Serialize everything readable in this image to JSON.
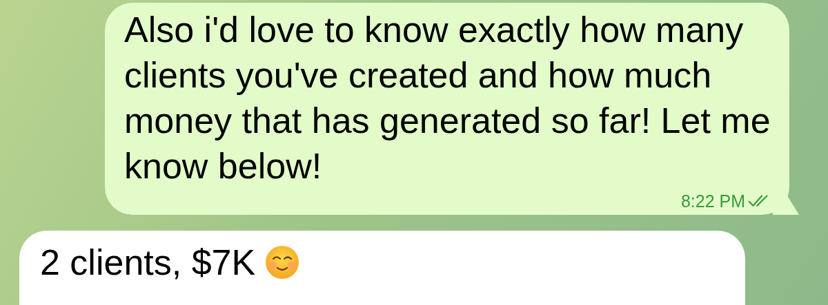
{
  "messages": [
    {
      "kind": "outgoing",
      "text": "Also i'd love to know exactly how many clients you've created and how much money that has generated so far! Let me know below!",
      "time": "8:22 PM",
      "read": true
    },
    {
      "kind": "incoming",
      "text": "2 clients, $7K",
      "emoji": true
    }
  ]
}
